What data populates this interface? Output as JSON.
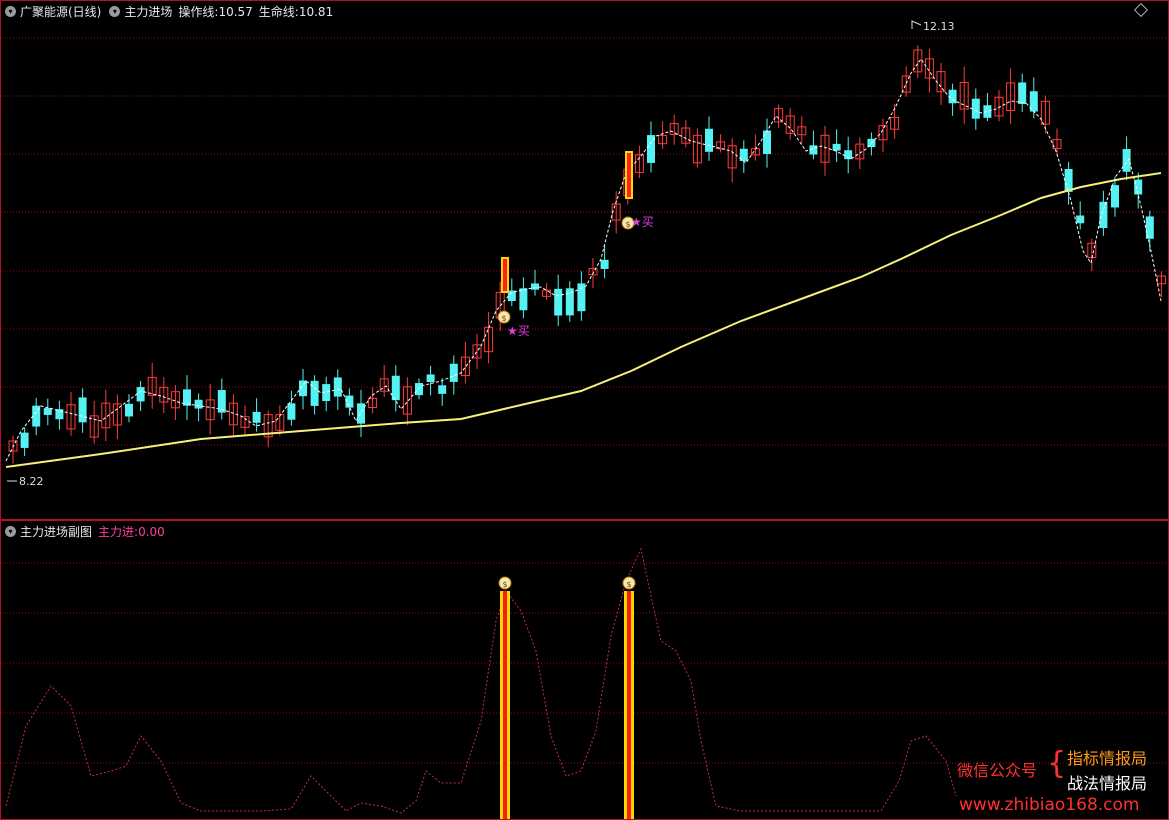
{
  "main_header": {
    "stock": "广聚能源(日线)",
    "indicator": "主力进场",
    "op_label": "操作线:",
    "op_value": "10.57",
    "life_label": "生命线:",
    "life_value": "10.81"
  },
  "sub_header": {
    "title": "主力进场副图",
    "value_label": "主力进:",
    "value": "0.00"
  },
  "annotations": {
    "high": "12.13",
    "low": "8.22",
    "buy1": "★买",
    "buy2": "★买"
  },
  "watermark": {
    "wechat": "微信公众号",
    "name1": "指标情报局",
    "name2": "战法情报局",
    "url": "www.zhibiao168.com"
  },
  "colors": {
    "up": "#ff3b3b",
    "down": "#54f2f2",
    "life_line": "#f5f07a",
    "grid": "#8b0a1e",
    "sub_line": "#c62b4a"
  }
}
